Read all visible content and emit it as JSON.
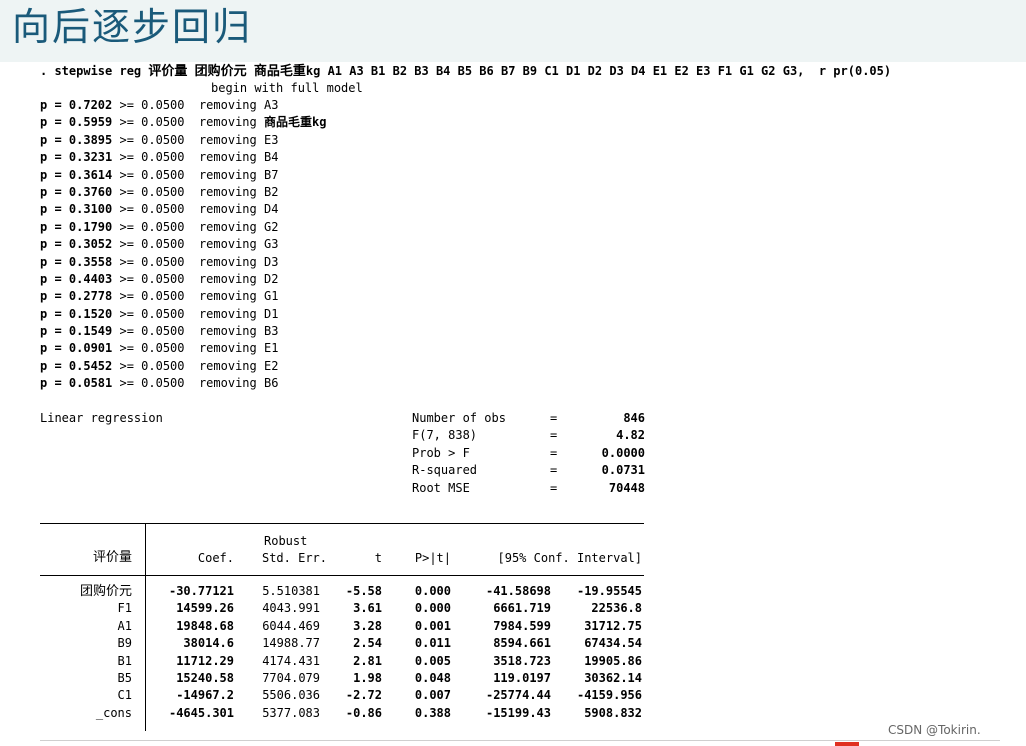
{
  "slide_title": "向后逐步回归",
  "command": {
    "prefix": ". stepwise reg",
    "dep_var": "评价量",
    "var1": "团购价元",
    "var2": "商品毛重",
    "rest": "kg A1 A3 B1 B2 B3 B4 B5 B6 B7 B9 C1 D1 D2 D3 D4 E1 E2 E3 F1 G1 G2 G3,  r pr(0.05)"
  },
  "begin_text": "begin with full model",
  "steps": [
    {
      "p": "p = 0.7202",
      "rest": " >= 0.0500  removing ",
      "var": "A3",
      "cn": ""
    },
    {
      "p": "p = 0.5959",
      "rest": " >= 0.0500  removing ",
      "var": "",
      "cn": "商品毛重",
      "suffix": "kg"
    },
    {
      "p": "p = 0.3895",
      "rest": " >= 0.0500  removing ",
      "var": "E3",
      "cn": ""
    },
    {
      "p": "p = 0.3231",
      "rest": " >= 0.0500  removing ",
      "var": "B4",
      "cn": ""
    },
    {
      "p": "p = 0.3614",
      "rest": " >= 0.0500  removing ",
      "var": "B7",
      "cn": ""
    },
    {
      "p": "p = 0.3760",
      "rest": " >= 0.0500  removing ",
      "var": "B2",
      "cn": ""
    },
    {
      "p": "p = 0.3100",
      "rest": " >= 0.0500  removing ",
      "var": "D4",
      "cn": ""
    },
    {
      "p": "p = 0.1790",
      "rest": " >= 0.0500  removing ",
      "var": "G2",
      "cn": ""
    },
    {
      "p": "p = 0.3052",
      "rest": " >= 0.0500  removing ",
      "var": "G3",
      "cn": ""
    },
    {
      "p": "p = 0.3558",
      "rest": " >= 0.0500  removing ",
      "var": "D3",
      "cn": ""
    },
    {
      "p": "p = 0.4403",
      "rest": " >= 0.0500  removing ",
      "var": "D2",
      "cn": ""
    },
    {
      "p": "p = 0.2778",
      "rest": " >= 0.0500  removing ",
      "var": "G1",
      "cn": ""
    },
    {
      "p": "p = 0.1520",
      "rest": " >= 0.0500  removing ",
      "var": "D1",
      "cn": ""
    },
    {
      "p": "p = 0.1549",
      "rest": " >= 0.0500  removing ",
      "var": "B3",
      "cn": ""
    },
    {
      "p": "p = 0.0901",
      "rest": " >= 0.0500  removing ",
      "var": "E1",
      "cn": ""
    },
    {
      "p": "p = 0.5452",
      "rest": " >= 0.0500  removing ",
      "var": "E2",
      "cn": ""
    },
    {
      "p": "p = 0.0581",
      "rest": " >= 0.0500  removing ",
      "var": "B6",
      "cn": ""
    }
  ],
  "regression_label": "Linear regression",
  "stats": [
    {
      "label": "Number of obs",
      "eq": "=",
      "value": "846"
    },
    {
      "label": "F(7, 838)",
      "eq": "=",
      "value": "4.82"
    },
    {
      "label": "Prob > F",
      "eq": "=",
      "value": "0.0000"
    },
    {
      "label": "R-squared",
      "eq": "=",
      "value": "0.0731"
    },
    {
      "label": "Root MSE",
      "eq": "=",
      "value": "70448"
    }
  ],
  "table": {
    "robust": "Robust",
    "dep_var": "评价量",
    "headers": [
      "Coef.",
      "Std. Err.",
      "t",
      "P>|t|",
      "[95% Conf. Interval]"
    ],
    "rows": [
      {
        "var": "团购价元",
        "coef": "-30.77121",
        "se": "5.510381",
        "t": "-5.58",
        "p": "0.000",
        "lo": "-41.58698",
        "hi": "-19.95545"
      },
      {
        "var": "F1",
        "coef": "14599.26",
        "se": "4043.991",
        "t": "3.61",
        "p": "0.000",
        "lo": "6661.719",
        "hi": "22536.8"
      },
      {
        "var": "A1",
        "coef": "19848.68",
        "se": "6044.469",
        "t": "3.28",
        "p": "0.001",
        "lo": "7984.599",
        "hi": "31712.75"
      },
      {
        "var": "B9",
        "coef": "38014.6",
        "se": "14988.77",
        "t": "2.54",
        "p": "0.011",
        "lo": "8594.661",
        "hi": "67434.54"
      },
      {
        "var": "B1",
        "coef": "11712.29",
        "se": "4174.431",
        "t": "2.81",
        "p": "0.005",
        "lo": "3518.723",
        "hi": "19905.86"
      },
      {
        "var": "B5",
        "coef": "15240.58",
        "se": "7704.079",
        "t": "1.98",
        "p": "0.048",
        "lo": "119.0197",
        "hi": "30362.14"
      },
      {
        "var": "C1",
        "coef": "-14967.2",
        "se": "5506.036",
        "t": "-2.72",
        "p": "0.007",
        "lo": "-25774.44",
        "hi": "-4159.956"
      },
      {
        "var": "_cons",
        "coef": "-4645.301",
        "se": "5377.083",
        "t": "-0.86",
        "p": "0.388",
        "lo": "-15199.43",
        "hi": "5908.832"
      }
    ]
  },
  "watermark": "CSDN @Tokirin."
}
